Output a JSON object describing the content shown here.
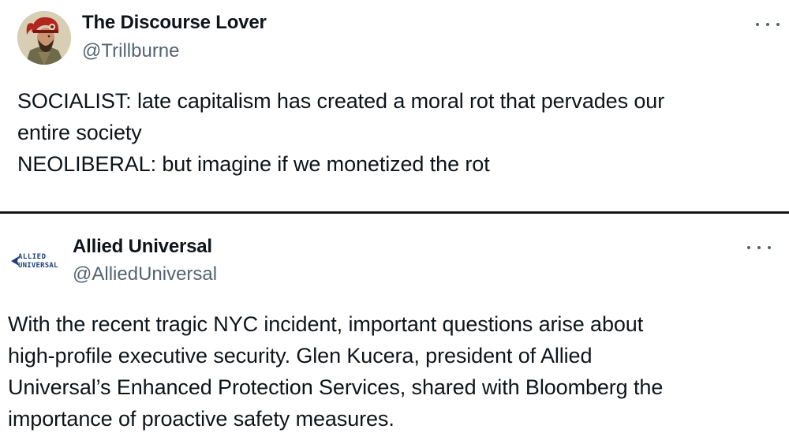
{
  "tweets": [
    {
      "display_name": "The Discourse Lover",
      "handle": "@Trillburne",
      "avatar_icon": "helmeted-warrior-portrait-icon",
      "more_icon": "more-options-icon",
      "text_lines": [
        "SOCIALIST: late capitalism has created a moral rot that pervades our",
        "entire society",
        "NEOLIBERAL: but imagine if we monetized the rot"
      ]
    },
    {
      "display_name": "Allied Universal",
      "handle": "@AlliedUniversal",
      "avatar_logo_text": [
        "ALLIED",
        "UNIVERSAL"
      ],
      "more_icon": "more-options-icon",
      "text_lines": [
        "With the recent tragic NYC incident, important questions arise about",
        "high-profile executive security. Glen Kucera, president of Allied",
        "Universal’s Enhanced Protection Services, shared with Bloomberg the",
        "importance of proactive safety measures."
      ]
    }
  ],
  "colors": {
    "text": "#0f1419",
    "secondary": "#536471",
    "divider": "#141414",
    "logo_blue": "#1d3f7a"
  }
}
